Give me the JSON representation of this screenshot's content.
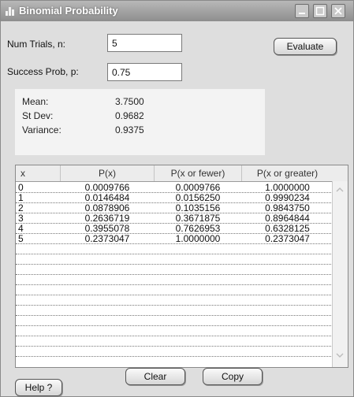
{
  "window": {
    "title": "Binomial Probability"
  },
  "inputs": {
    "trials_label": "Num Trials, n:",
    "trials_value": "5",
    "prob_label": "Success Prob, p:",
    "prob_value": "0.75"
  },
  "buttons": {
    "evaluate": "Evaluate",
    "clear": "Clear",
    "copy": "Copy",
    "help": "Help ?"
  },
  "stats": [
    {
      "label": "Mean:",
      "value": "3.7500"
    },
    {
      "label": "St Dev:",
      "value": "0.9682"
    },
    {
      "label": "Variance:",
      "value": "0.9375"
    }
  ],
  "table": {
    "headers": [
      "x",
      "P(x)",
      "P(x or fewer)",
      "P(x or greater)"
    ],
    "rows": [
      [
        "0",
        "0.0009766",
        "0.0009766",
        "1.0000000"
      ],
      [
        "1",
        "0.0146484",
        "0.0156250",
        "0.9990234"
      ],
      [
        "2",
        "0.0878906",
        "0.1035156",
        "0.9843750"
      ],
      [
        "3",
        "0.2636719",
        "0.3671875",
        "0.8964844"
      ],
      [
        "4",
        "0.3955078",
        "0.7626953",
        "0.6328125"
      ],
      [
        "5",
        "0.2373047",
        "1.0000000",
        "0.2373047"
      ]
    ]
  }
}
